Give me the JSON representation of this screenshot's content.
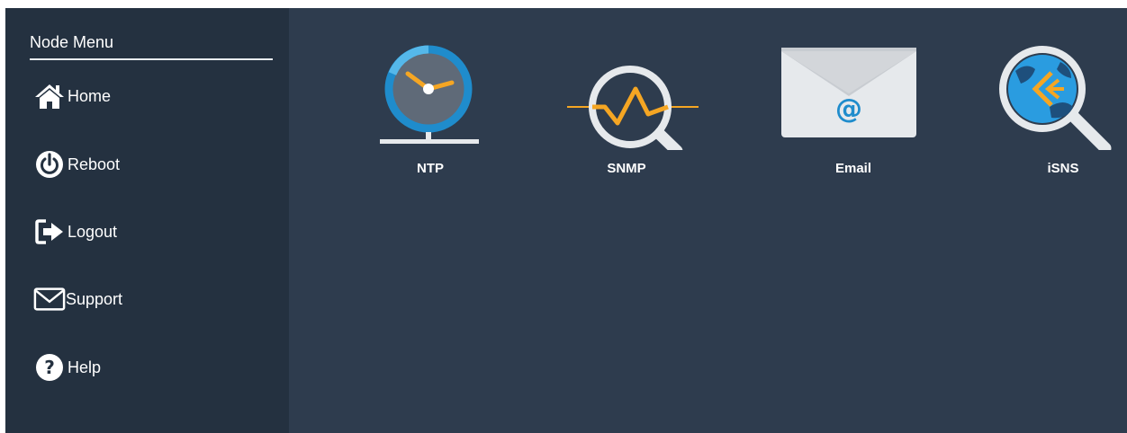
{
  "sidebar": {
    "title": "Node Menu",
    "items": [
      {
        "label": "Home",
        "icon": "home-icon"
      },
      {
        "label": "Reboot",
        "icon": "power-icon"
      },
      {
        "label": "Logout",
        "icon": "logout-icon"
      },
      {
        "label": "Support",
        "icon": "envelope-icon"
      },
      {
        "label": "Help",
        "icon": "question-circle-icon"
      }
    ]
  },
  "main": {
    "tiles": [
      {
        "label": "NTP",
        "icon": "clock-icon"
      },
      {
        "label": "SNMP",
        "icon": "magnifier-signal-icon"
      },
      {
        "label": "Email",
        "icon": "email-envelope-icon"
      },
      {
        "label": "iSNS",
        "icon": "magnifier-isns-icon"
      }
    ]
  },
  "colors": {
    "sidebar_bg": "#243140",
    "main_bg": "#2e3c4e",
    "accent_blue": "#3ba0dc",
    "accent_orange": "#f5a623"
  }
}
